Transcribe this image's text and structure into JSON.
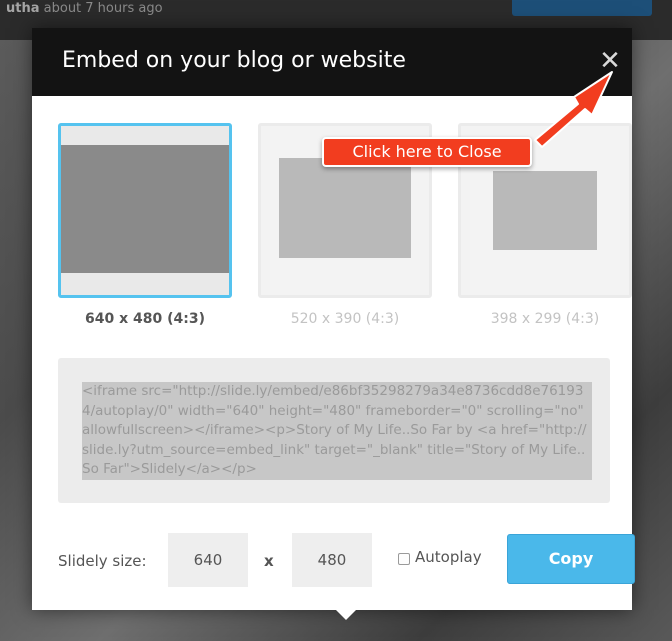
{
  "background": {
    "header_prefix": "utha",
    "header_text": "about 7 hours ago"
  },
  "modal": {
    "title": "Embed on your blog or website",
    "close_label": "✕"
  },
  "sizes": [
    {
      "label": "640 x 480 (4:3)",
      "selected": true
    },
    {
      "label": "520 x 390 (4:3)",
      "selected": false
    },
    {
      "label": "398 x 299 (4:3)",
      "selected": false
    }
  ],
  "embed_code": "<iframe src=\"http://slide.ly/embed/e86bf35298279a34e8736cdd8e761934/autoplay/0\" width=\"640\" height=\"480\" frameborder=\"0\" scrolling=\"no\" allowfullscreen></iframe><p>Story of My Life..So Far by <a href=\"http://slide.ly?utm_source=embed_link\" target=\"_blank\" title=\"Story of My Life..So Far\">Slidely</a></p>",
  "controls": {
    "size_label": "Slidely size:",
    "width": "640",
    "height": "480",
    "separator": "x",
    "autoplay_label": "Autoplay",
    "autoplay_checked": false,
    "copy_label": "Copy"
  },
  "annotation": {
    "text": "Click here to Close",
    "color": "#f23d1f"
  },
  "colors": {
    "accent": "#4ab8ea",
    "selected_border": "#55c3ef",
    "header_bg": "#131313"
  }
}
